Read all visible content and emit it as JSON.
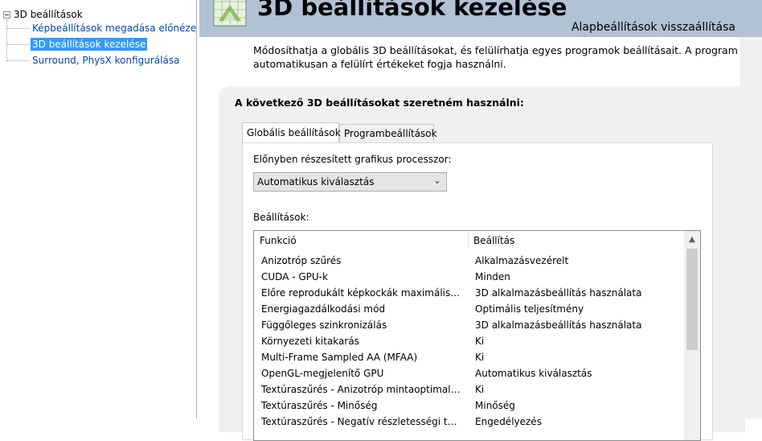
{
  "tree": {
    "root_label": "3D beállítások",
    "items": [
      {
        "label": "Képbeállítások megadása előnézettel"
      },
      {
        "label": "3D beállítások kezelése",
        "selected": true
      },
      {
        "label": "Surround, PhysX konfigurálása"
      }
    ]
  },
  "header": {
    "icon": "nvidia-3d-settings-icon",
    "title": "3D beállítások kezelése",
    "restore_link": "Alapbeállítások visszaállítása"
  },
  "description": {
    "line1": "Módosíthatja a globális 3D beállításokat, és felülírhatja egyes programok beállításait. A program minden",
    "line2": "automatikusan a felülírt értékeket fogja használni."
  },
  "panel": {
    "title": "A következő 3D beállításokat szeretném használni:",
    "tabs": [
      {
        "label": "Globális beállítások",
        "active": true
      },
      {
        "label": "Programbeállítások",
        "active": false
      }
    ],
    "gpu_label": "Előnyben részesített grafikus processzor:",
    "gpu_value": "Automatikus kiválasztás",
    "settings_label": "Beállítások:",
    "table": {
      "headers": [
        "Funkció",
        "Beállítás"
      ],
      "rows": [
        [
          "Anizotróp szűrés",
          "Alkalmazásvezérelt"
        ],
        [
          "CUDA - GPU-k",
          "Minden"
        ],
        [
          "Előre reprodukált képkockák maximális száma",
          "3D alkalmazásbeállítás használata"
        ],
        [
          "Energiagazdálkodási mód",
          "Optimális teljesítmény"
        ],
        [
          "Függőleges szinkronizálás",
          "3D alkalmazásbeállítás használata"
        ],
        [
          "Környezeti kitakarás",
          "Ki"
        ],
        [
          "Multi-Frame Sampled AA (MFAA)",
          "Ki"
        ],
        [
          "OpenGL-megjelenítő GPU",
          "Automatikus kiválasztás"
        ],
        [
          "Textúraszűrés - Anizotróp mintaoptimalizálás",
          "Ki"
        ],
        [
          "Textúraszűrés - Minőség",
          "Minőség"
        ],
        [
          "Textúraszűrés - Negatív részletességi torzítás",
          "Engedélyezés"
        ]
      ]
    }
  },
  "colors": {
    "header_bg": "#b0c2d4",
    "tree_selected_bg": "#3399ff",
    "tree_link": "#0645ad",
    "panel_bg": "#f0f0f0"
  }
}
